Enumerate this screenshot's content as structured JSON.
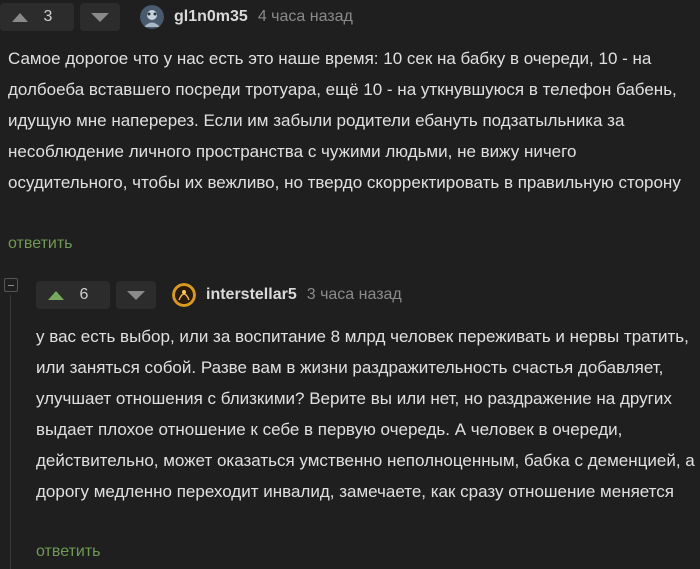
{
  "comment1": {
    "vote_count": "3",
    "username": "gl1n0m35",
    "timestamp": "4 часа назад",
    "text": "Самое дорогое что у нас есть это наше время: 10 сек на бабку в очереди, 10 - на долбоеба вставшего посреди тротуара, ещё 10 - на уткнувшуюся в телефон бабень, идущую мне наперерез. Если им забыли родители ебануть подзатыльника за несоблюдение личного пространства с чужими людьми, не вижу ничего осудительного, чтобы их вежливо, но твердо скорректировать в правильную сторону",
    "reply_label": "ответить"
  },
  "comment2": {
    "vote_count": "6",
    "username": "interstellar5",
    "timestamp": "3 часа назад",
    "text": "у вас есть выбор, или за воспитание 8 млрд человек переживать и нервы тратить, или заняться собой. Разве вам в жизни раздражительность счастья добавляет, улучшает отношения с близкими? Верите вы или нет, но раздражение на других выдает плохое отношение к себе в первую очередь. А человек в очереди, действительно, может оказаться умственно неполноценным, бабка с деменцией, а дорогу медленно переходит инвалид, замечаете, как сразу отношение меняется",
    "reply_label": "ответить"
  },
  "colors": {
    "background": "#1f1f1f",
    "upvote_active": "#78a95c",
    "reply_link": "#6f9a52",
    "muted": "#8a8a8a"
  },
  "icons": {
    "upvote": "triangle-up",
    "downvote": "triangle-down",
    "collapse": "minus-square"
  }
}
